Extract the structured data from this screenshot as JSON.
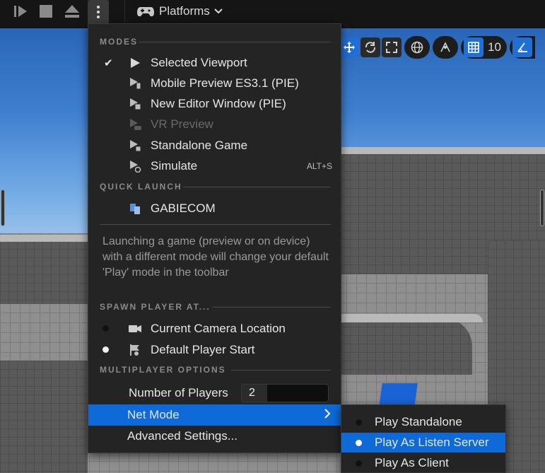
{
  "toolbar": {
    "platforms_label": "Platforms",
    "grid_value": "10"
  },
  "menu": {
    "modes_header": "MODES",
    "modes": [
      {
        "label": "Selected Viewport",
        "checked": true,
        "icon": "play-icon",
        "enabled": true
      },
      {
        "label": "Mobile Preview ES3.1 (PIE)",
        "checked": false,
        "icon": "mobile-preview-icon",
        "enabled": true
      },
      {
        "label": "New Editor Window (PIE)",
        "checked": false,
        "icon": "new-window-icon",
        "enabled": true
      },
      {
        "label": "VR Preview",
        "checked": false,
        "icon": "vr-icon",
        "enabled": false
      },
      {
        "label": "Standalone Game",
        "checked": false,
        "icon": "standalone-icon",
        "enabled": true
      },
      {
        "label": "Simulate",
        "checked": false,
        "icon": "simulate-icon",
        "enabled": true,
        "shortcut": "ALT+S"
      }
    ],
    "quick_launch_header": "QUICK LAUNCH",
    "quick_launch": [
      {
        "label": "GABIECOM",
        "icon": "device-icon"
      }
    ],
    "note": "Launching a game (preview or on device) with a different mode will change your default 'Play' mode in the toolbar",
    "spawn_header": "SPAWN PLAYER AT...",
    "spawn": [
      {
        "label": "Current Camera Location",
        "selected": false,
        "icon": "camera-icon"
      },
      {
        "label": "Default Player Start",
        "selected": true,
        "icon": "player-start-icon"
      }
    ],
    "multiplayer_header": "MULTIPLAYER OPTIONS",
    "num_players_label": "Number of Players",
    "num_players_value": "2",
    "net_mode_label": "Net Mode",
    "advanced_label": "Advanced Settings..."
  },
  "net_mode_submenu": [
    {
      "label": "Play Standalone",
      "selected": false
    },
    {
      "label": "Play As Listen Server",
      "selected": true
    },
    {
      "label": "Play As Client",
      "selected": false
    }
  ],
  "colors": {
    "accent": "#0d6ad8",
    "menu_bg": "#242424"
  }
}
